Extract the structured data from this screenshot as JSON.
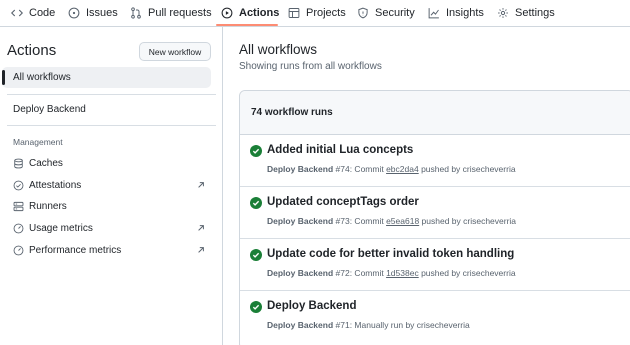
{
  "nav": {
    "tabs": [
      {
        "label": "Code",
        "icon": "code-icon"
      },
      {
        "label": "Issues",
        "icon": "issue-icon"
      },
      {
        "label": "Pull requests",
        "icon": "pull-request-icon"
      },
      {
        "label": "Actions",
        "icon": "play-icon",
        "active": true
      },
      {
        "label": "Projects",
        "icon": "table-icon"
      },
      {
        "label": "Security",
        "icon": "shield-icon"
      },
      {
        "label": "Insights",
        "icon": "graph-icon"
      },
      {
        "label": "Settings",
        "icon": "gear-icon"
      }
    ]
  },
  "sidebar": {
    "title": "Actions",
    "new_workflow": "New workflow",
    "all_workflows": "All workflows",
    "workflows": [
      "Deploy Backend"
    ],
    "management_label": "Management",
    "management": [
      {
        "label": "Caches",
        "icon": "database-icon"
      },
      {
        "label": "Attestations",
        "icon": "verified-icon",
        "external": true
      },
      {
        "label": "Runners",
        "icon": "server-icon"
      },
      {
        "label": "Usage metrics",
        "icon": "meter-icon",
        "external": true
      },
      {
        "label": "Performance metrics",
        "icon": "meter-icon",
        "external": true
      }
    ]
  },
  "main": {
    "title": "All workflows",
    "subtitle": "Showing runs from all workflows",
    "runs_count": "74 workflow runs",
    "runs": [
      {
        "title": "Added initial Lua concepts",
        "workflow": "Deploy Backend",
        "number": "#74",
        "trigger_prefix": ": Commit ",
        "sha": "ebc2da4",
        "trigger_suffix": " pushed by crisecheverria"
      },
      {
        "title": "Updated conceptTags order",
        "workflow": "Deploy Backend",
        "number": "#73",
        "trigger_prefix": ": Commit ",
        "sha": "e5ea618",
        "trigger_suffix": " pushed by crisecheverria"
      },
      {
        "title": "Update code for better invalid token handling",
        "workflow": "Deploy Backend",
        "number": "#72",
        "trigger_prefix": ": Commit ",
        "sha": "1d538ec",
        "trigger_suffix": " pushed by crisecheverria"
      },
      {
        "title": "Deploy Backend",
        "workflow": "Deploy Backend",
        "number": "#71",
        "trigger_prefix": ": Manually run by crisecheverria",
        "sha": "",
        "trigger_suffix": ""
      }
    ]
  },
  "colors": {
    "success": "#1a7f37",
    "active_underline": "#fd8c73"
  }
}
